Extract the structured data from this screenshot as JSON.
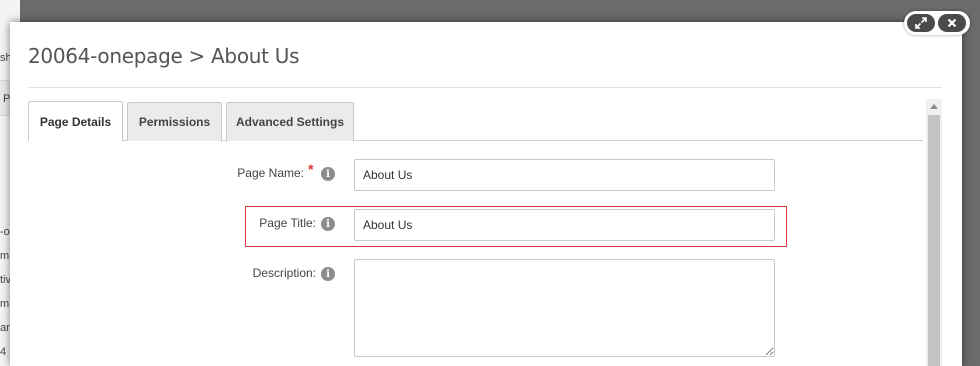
{
  "background_fragments": [
    "sh",
    "P",
    "-o",
    "m",
    "tiv",
    "m",
    "ar",
    "4"
  ],
  "modal": {
    "title": "20064-onepage > About Us",
    "controls": {
      "expand_icon": "expand-icon",
      "close_icon": "close-icon"
    }
  },
  "tabs": [
    {
      "label": "Page Details",
      "active": true
    },
    {
      "label": "Permissions",
      "active": false
    },
    {
      "label": "Advanced Settings",
      "active": false
    }
  ],
  "form": {
    "page_name": {
      "label": "Page Name:",
      "required": "*",
      "value": "About Us"
    },
    "page_title": {
      "label": "Page Title:",
      "value": "About Us"
    },
    "description": {
      "label": "Description:",
      "value": ""
    }
  },
  "info_icon_glyph": "i",
  "colors": {
    "highlight": "#d9363e",
    "required": "#e03030",
    "overlay": "#6b6b6b"
  }
}
